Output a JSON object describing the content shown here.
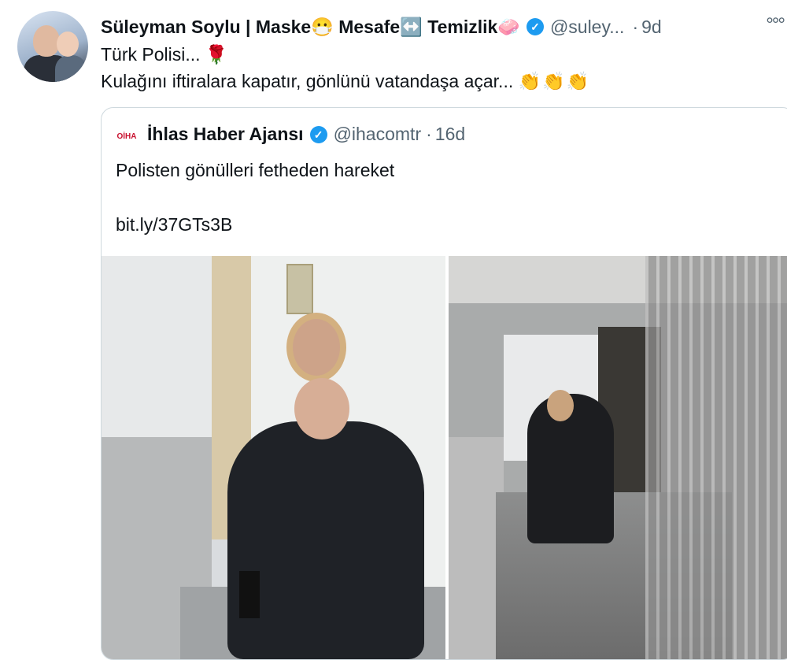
{
  "author": {
    "name": "Süleyman Soylu | Maske😷 Mesafe↔️ Temizlik🧼",
    "handle": "@suley...",
    "separator": "·",
    "time": "9d",
    "more_icon": "more-icon"
  },
  "tweet": {
    "line1_text": "Türk Polisi... ",
    "line1_emoji": "🌹",
    "line2_text": "Kulağını iftiralara kapatır, gönlünü vatandaşa açar... ",
    "line2_emoji": "👏👏👏"
  },
  "quoted": {
    "logo_text": "OİHA",
    "name": "İhlas Haber Ajansı",
    "handle": "@ihacomtr",
    "separator": "·",
    "time": "16d",
    "text": "Polisten gönülleri fetheden hareket",
    "link": "bit.ly/37GTs3B"
  },
  "colors": {
    "verified": "#1d9bf0",
    "secondary_text": "#536471",
    "border": "#cfd9de"
  }
}
